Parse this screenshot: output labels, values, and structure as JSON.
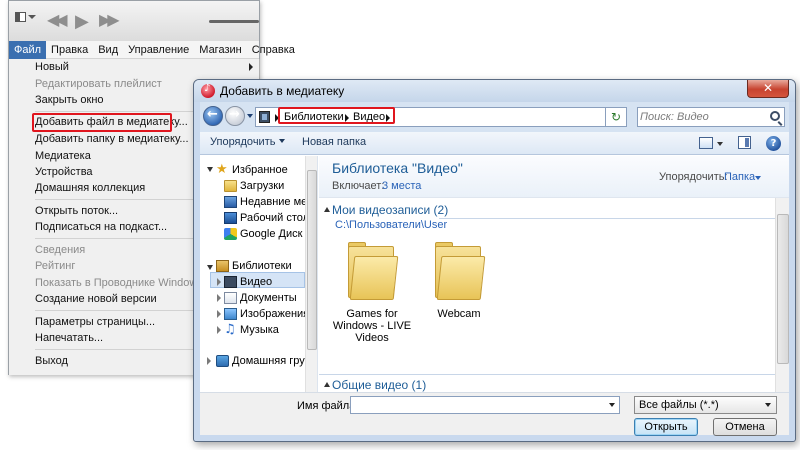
{
  "itunes": {
    "menubar": [
      "Файл",
      "Правка",
      "Вид",
      "Управление",
      "Магазин",
      "Справка"
    ],
    "file_menu": [
      {
        "label": "Новый",
        "disabled": false,
        "submenu": true
      },
      {
        "label": "Редактировать плейлист",
        "disabled": true
      },
      {
        "label": "Закрыть окно",
        "disabled": false
      },
      {
        "label": "Добавить файл в медиатеку...",
        "disabled": false,
        "highlighted": true
      },
      {
        "label": "Добавить папку в медиатеку...",
        "disabled": false
      },
      {
        "label": "Медиатека",
        "disabled": false
      },
      {
        "label": "Устройства",
        "disabled": false
      },
      {
        "label": "Домашняя коллекция",
        "disabled": false
      },
      {
        "label": "Открыть поток...",
        "disabled": false
      },
      {
        "label": "Подписаться на подкаст...",
        "disabled": false
      },
      {
        "label": "Сведения",
        "disabled": true
      },
      {
        "label": "Рейтинг",
        "disabled": true
      },
      {
        "label": "Показать в Проводнике Windows",
        "disabled": true
      },
      {
        "label": "Создание новой версии",
        "disabled": false
      },
      {
        "label": "Параметры страницы...",
        "disabled": false
      },
      {
        "label": "Напечатать...",
        "disabled": false
      },
      {
        "label": "Выход",
        "disabled": false
      }
    ],
    "highlight_color": "#e0161e"
  },
  "dialog": {
    "title": "Добавить в медиатеку",
    "close_glyph": "✕",
    "breadcrumb": [
      "Библиотеки",
      "Видео"
    ],
    "search_placeholder": "Поиск: Видео",
    "toolbar": {
      "organize": "Упорядочить",
      "new_folder": "Новая папка"
    },
    "nav": {
      "favorites": "Избранное",
      "favorites_items": [
        "Загрузки",
        "Недавние места",
        "Рабочий стол",
        "Google Диск"
      ],
      "libraries": "Библиотеки",
      "libraries_items": [
        "Видео",
        "Документы",
        "Изображения",
        "Музыка"
      ],
      "homegroup": "Домашняя группа"
    },
    "library": {
      "title": "Библиотека \"Видео\"",
      "includes_label": "Включает:",
      "includes_value": "3 места",
      "arrange_label": "Упорядочить:",
      "arrange_value": "Папка"
    },
    "groups": [
      {
        "header": "Мои видеозаписи (2)",
        "path": "C:\\Пользователи\\User",
        "folders": [
          "Games for Windows - LIVE Videos",
          "Webcam"
        ]
      },
      {
        "header": "Общие видео (1)"
      }
    ],
    "bottom": {
      "filename_label": "Имя файла:",
      "filename_value": "",
      "filter_value": "Все файлы (*.*)",
      "open_label": "Открыть",
      "cancel_label": "Отмена"
    }
  }
}
